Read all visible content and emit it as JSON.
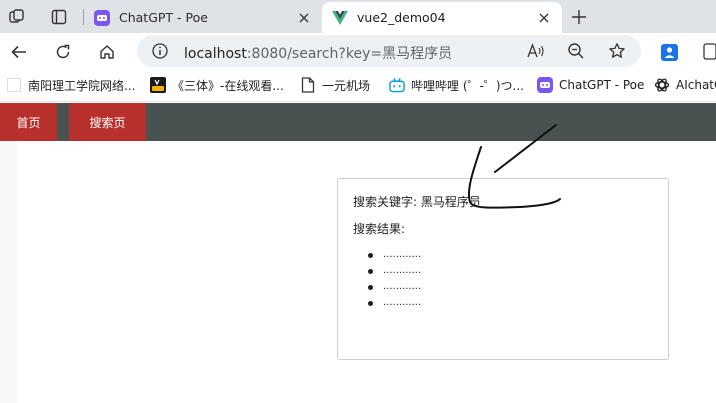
{
  "tabs": [
    {
      "title": "ChatGPT - Poe",
      "icon": "poe-icon"
    },
    {
      "title": "vue2_demo04",
      "icon": "vue-icon"
    }
  ],
  "address_bar": {
    "host": "localhost",
    "rest": ":8080/search?key=黑马程序员"
  },
  "bookmarks": [
    {
      "label": "南阳理工学院网络...",
      "icon": "blank-favicon"
    },
    {
      "label": "《三体》-在线观看...",
      "icon": "vid-favicon"
    },
    {
      "label": "一元机场",
      "icon": "page-icon"
    },
    {
      "label": "哔哩哔哩 (゜-゜)つ...",
      "icon": "bilibili-icon"
    },
    {
      "label": "ChatGPT - Poe",
      "icon": "poe-icon"
    },
    {
      "label": "AIchatOS",
      "icon": "openai-icon"
    }
  ],
  "nav": {
    "home": "首页",
    "search": "搜索页"
  },
  "search": {
    "keyword_label": "搜索关键字: 黑马程序员",
    "results_label": "搜索结果:",
    "results": [
      "............",
      "............",
      "............",
      "............"
    ]
  },
  "colors": {
    "nav_bg": "#495250",
    "nav_active": "#b8302b",
    "tabstrip": "#dfe3e8",
    "poe": "#7b57f2",
    "vue": "#41b883"
  }
}
